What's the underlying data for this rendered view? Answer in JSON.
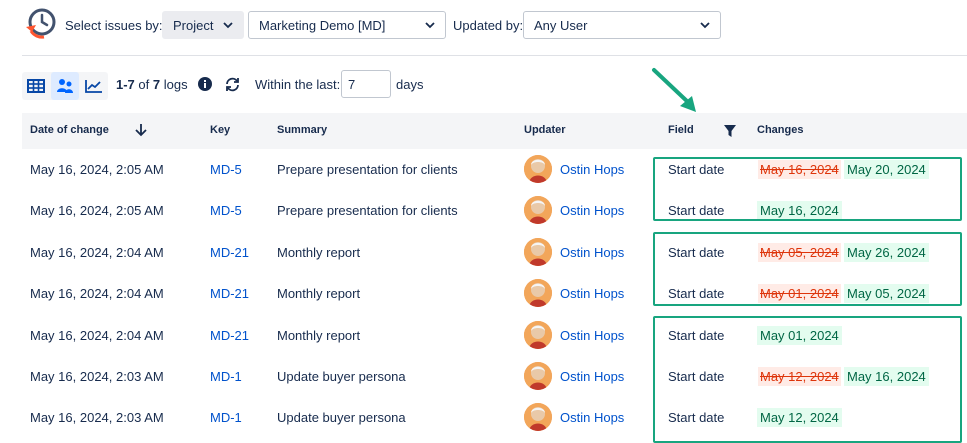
{
  "header": {
    "select_by_label": "Select issues by:",
    "select_by_value": "Project",
    "project_value": "Marketing Demo [MD]",
    "updated_by_label": "Updated by:",
    "updated_by_value": "Any User"
  },
  "toolbar": {
    "range": "1-7",
    "of": "of",
    "total": "7",
    "logs": "logs",
    "within_label": "Within the last:",
    "within_value": "7",
    "days_label": "days"
  },
  "table": {
    "columns": [
      "Date of change",
      "Key",
      "Summary",
      "Updater",
      "Field",
      "Changes"
    ],
    "rows": [
      {
        "date": "May 16, 2024, 2:05 AM",
        "key": "MD-5",
        "summary": "Prepare presentation for clients",
        "updater": "Ostin Hops",
        "field": "Start date",
        "old": "May 16, 2024",
        "new": "May 20, 2024"
      },
      {
        "date": "May 16, 2024, 2:05 AM",
        "key": "MD-5",
        "summary": "Prepare presentation for clients",
        "updater": "Ostin Hops",
        "field": "Start date",
        "old": "",
        "new": "May 16, 2024"
      },
      {
        "date": "May 16, 2024, 2:04 AM",
        "key": "MD-21",
        "summary": "Monthly report",
        "updater": "Ostin Hops",
        "field": "Start date",
        "old": "May 05, 2024",
        "new": "May 26, 2024"
      },
      {
        "date": "May 16, 2024, 2:04 AM",
        "key": "MD-21",
        "summary": "Monthly report",
        "updater": "Ostin Hops",
        "field": "Start date",
        "old": "May 01, 2024",
        "new": "May 05, 2024"
      },
      {
        "date": "May 16, 2024, 2:04 AM",
        "key": "MD-21",
        "summary": "Monthly report",
        "updater": "Ostin Hops",
        "field": "Start date",
        "old": "",
        "new": "May 01, 2024"
      },
      {
        "date": "May 16, 2024, 2:03 AM",
        "key": "MD-1",
        "summary": "Update buyer persona",
        "updater": "Ostin Hops",
        "field": "Start date",
        "old": "May 12, 2024",
        "new": "May 16, 2024"
      },
      {
        "date": "May 16, 2024, 2:03 AM",
        "key": "MD-1",
        "summary": "Update buyer persona",
        "updater": "Ostin Hops",
        "field": "Start date",
        "old": "",
        "new": "May 12, 2024"
      }
    ]
  },
  "colors": {
    "link": "#0052cc",
    "highlight_border": "#18a57f",
    "old_value": "#de350b",
    "new_value": "#006644"
  },
  "icons": [
    "history-clock-icon",
    "chevron-down-icon",
    "table-view-icon",
    "users-view-icon",
    "chart-view-icon",
    "info-icon",
    "refresh-icon",
    "sort-down-icon",
    "filter-icon",
    "avatar"
  ]
}
